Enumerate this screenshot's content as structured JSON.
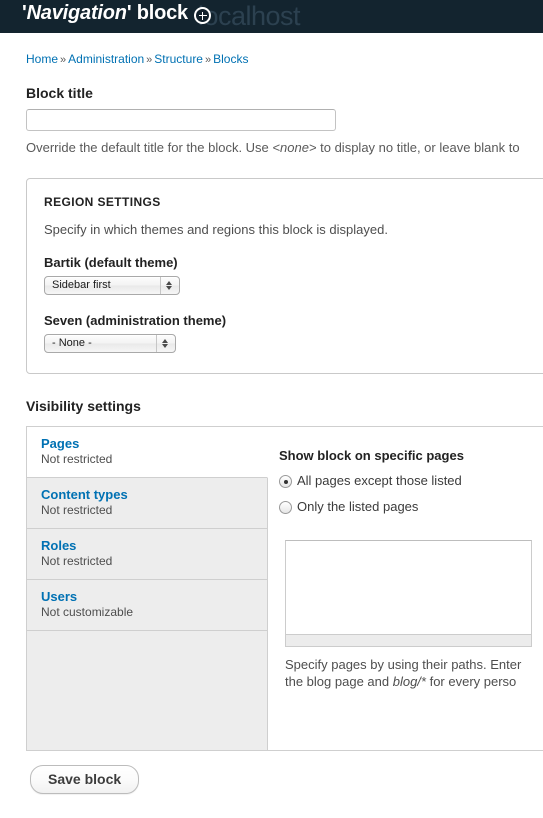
{
  "header": {
    "watermark": "localhost",
    "title_prefix": "'",
    "title_emphasis": "Navigation",
    "title_suffix": "' block",
    "cursor_icon": "crosshair-circle-icon",
    "background_color": "#13242f"
  },
  "breadcrumb": {
    "separator": "»",
    "items": [
      {
        "label": "Home"
      },
      {
        "label": "Administration"
      },
      {
        "label": "Structure"
      },
      {
        "label": "Blocks"
      }
    ]
  },
  "block_title": {
    "label": "Block title",
    "value": "",
    "placeholder": "",
    "description_part1": "Override the default title for the block. Use ",
    "description_code": "<none>",
    "description_part2": " to display no title, or leave blank to"
  },
  "region_settings": {
    "legend": "REGION SETTINGS",
    "description": "Specify in which themes and regions this block is displayed.",
    "themes": [
      {
        "label": "Bartik (default theme)",
        "selected": "Sidebar first"
      },
      {
        "label": "Seven (administration theme)",
        "selected": "- None -"
      }
    ]
  },
  "visibility": {
    "label": "Visibility settings",
    "tabs": [
      {
        "title": "Pages",
        "summary": "Not restricted",
        "active": true
      },
      {
        "title": "Content types",
        "summary": "Not restricted",
        "active": false
      },
      {
        "title": "Roles",
        "summary": "Not restricted",
        "active": false
      },
      {
        "title": "Users",
        "summary": "Not customizable",
        "active": false
      }
    ],
    "pane": {
      "title": "Show block on specific pages",
      "options": [
        {
          "label": "All pages except those listed",
          "checked": true
        },
        {
          "label": "Only the listed pages",
          "checked": false
        }
      ],
      "textarea_value": "",
      "description_line1": "Specify pages by using their paths. Enter",
      "description_line2_part1": "the blog page and ",
      "description_line2_code": "blog/*",
      "description_line2_part2": " for every perso"
    }
  },
  "actions": {
    "save_label": "Save block"
  },
  "colors": {
    "link": "#0071b3",
    "header_bg": "#13242f",
    "tab_inactive_bg": "#ededed"
  }
}
